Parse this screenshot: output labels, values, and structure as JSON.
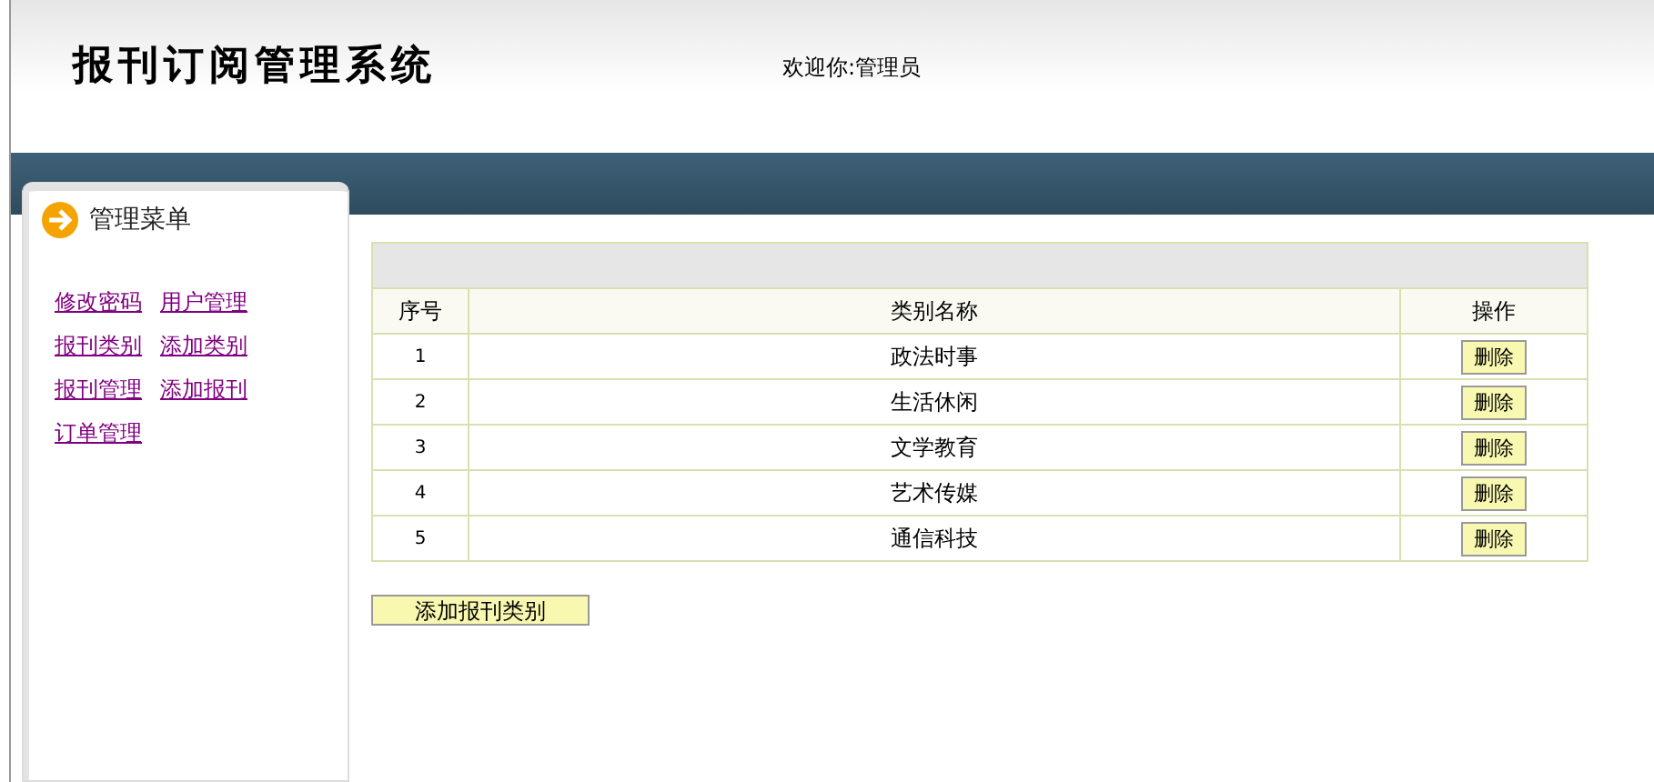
{
  "header": {
    "title": "报刊订阅管理系统",
    "welcome": "欢迎你:管理员"
  },
  "menu": {
    "title": "管理菜单",
    "links": [
      "修改密码",
      "用户管理",
      "报刊类别",
      "添加类别",
      "报刊管理",
      "添加报刊",
      "订单管理"
    ]
  },
  "table": {
    "columns": [
      "序号",
      "类别名称",
      "操作"
    ],
    "rows": [
      {
        "index": "1",
        "name": "政法时事",
        "action": "删除"
      },
      {
        "index": "2",
        "name": "生活休闲",
        "action": "删除"
      },
      {
        "index": "3",
        "name": "文学教育",
        "action": "删除"
      },
      {
        "index": "4",
        "name": "艺术传媒",
        "action": "删除"
      },
      {
        "index": "5",
        "name": "通信科技",
        "action": "删除"
      }
    ]
  },
  "add_button": "添加报刊类别"
}
